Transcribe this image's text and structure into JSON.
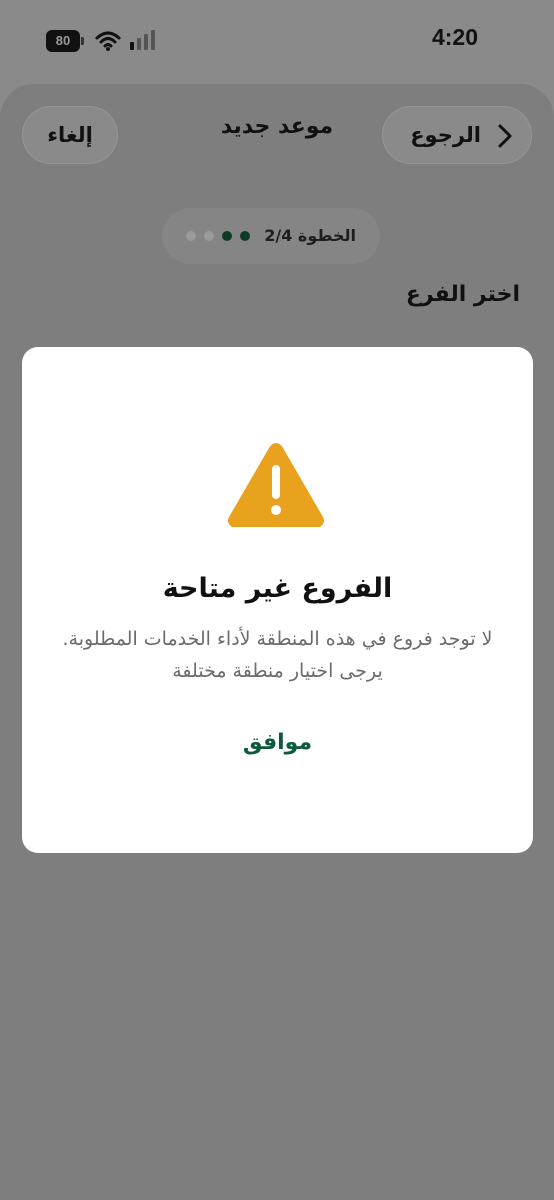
{
  "status_bar": {
    "time": "4:20",
    "battery_level": "80",
    "wifi_icon": "wifi-icon",
    "signal_icon": "cellular-signal-icon"
  },
  "header": {
    "back_label": "الرجوع",
    "title": "موعد جديد",
    "cancel_label": "إلغاء"
  },
  "steps": {
    "label": "الخطوة 2/4",
    "current": 2,
    "total": 4,
    "active_color": "#0e3a26",
    "inactive_color": "#9a9a9a"
  },
  "section": {
    "heading": "اختر الفرع"
  },
  "dialog": {
    "icon": "warning-icon",
    "icon_color": "#e8a21e",
    "title": "الفروع غير متاحة",
    "message": "لا توجد فروع في هذه المنطقة لأداء الخدمات المطلوبة. يرجى اختيار منطقة مختلفة",
    "ok_label": "موافق",
    "ok_color": "#0e5a3b"
  }
}
